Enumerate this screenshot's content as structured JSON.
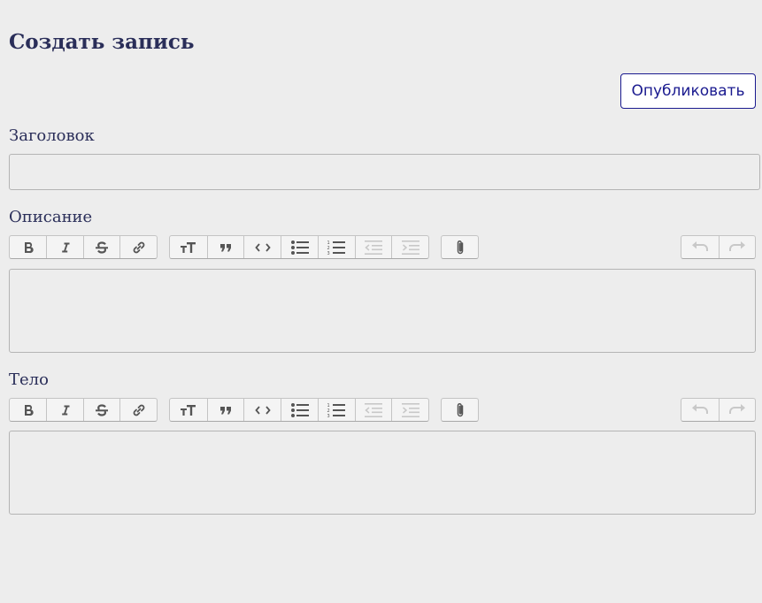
{
  "page": {
    "title": "Создать запись"
  },
  "actions": {
    "publish_label": "Опубликовать"
  },
  "form": {
    "title_field": {
      "label": "Заголовок",
      "value": "",
      "placeholder": ""
    },
    "description_field": {
      "label": "Описание",
      "value": ""
    },
    "body_field": {
      "label": "Тело",
      "value": ""
    }
  },
  "toolbar": {
    "text_formatting": [
      "bold-icon",
      "italic-icon",
      "strikethrough-icon",
      "link-icon"
    ],
    "block_formatting": [
      "heading-icon",
      "quote-icon",
      "code-icon",
      "bullet-list-icon",
      "numbered-list-icon",
      "decrease-indent-icon",
      "increase-indent-icon"
    ],
    "file_tools": [
      "attach-file-icon"
    ],
    "history_tools": [
      "undo-icon",
      "redo-icon"
    ],
    "disabled_tools": [
      "decrease-indent-icon",
      "increase-indent-icon",
      "undo-icon",
      "redo-icon"
    ]
  },
  "colors": {
    "background": "#ededed",
    "title_text": "#2a2e59",
    "publish_accent": "#1a1a8f",
    "icon_active": "#555555",
    "icon_disabled": "#c8c8c8"
  }
}
